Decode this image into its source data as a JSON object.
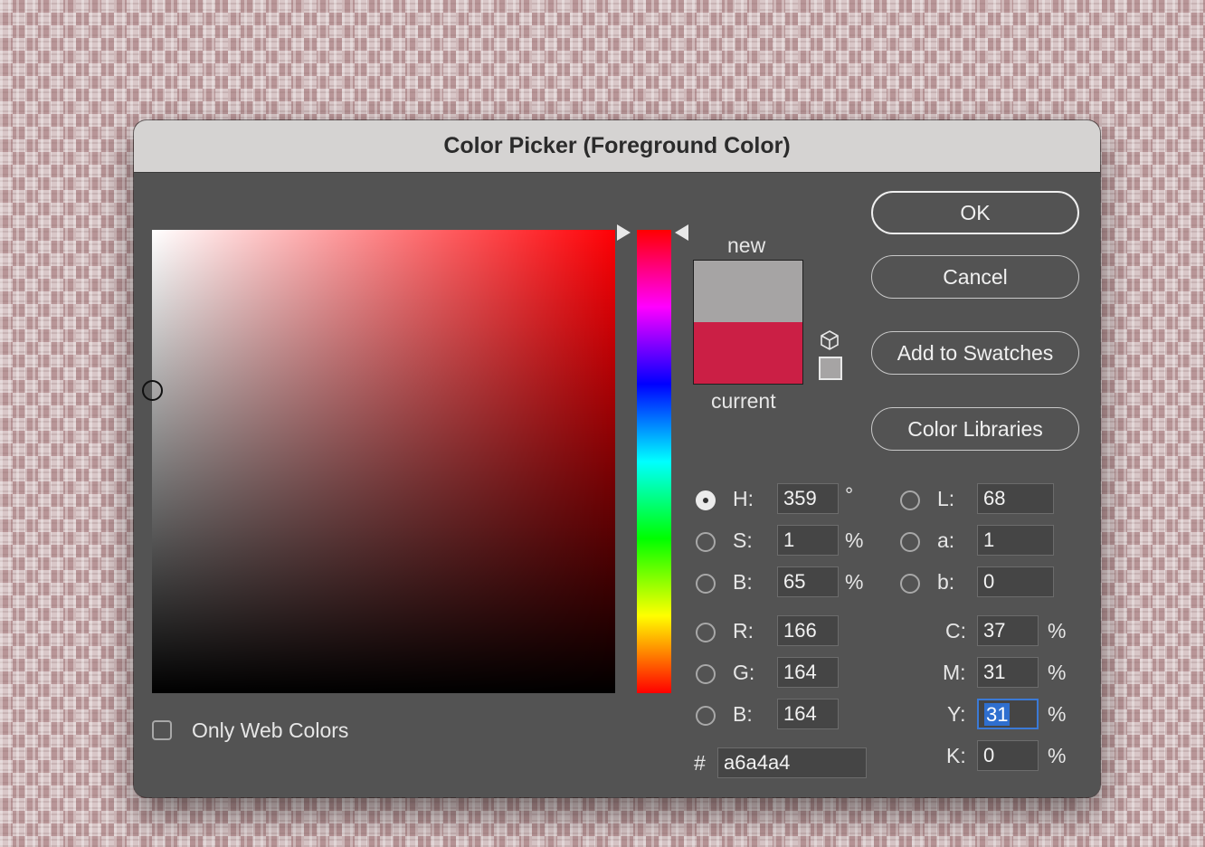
{
  "dialog": {
    "title": "Color Picker (Foreground Color)"
  },
  "colors": {
    "new": "#a6a4a4",
    "current": "#cb1f45",
    "field_hue": "#ff0005"
  },
  "preview": {
    "new_label": "new",
    "current_label": "current"
  },
  "buttons": {
    "ok": "OK",
    "cancel": "Cancel",
    "add_to_swatches": "Add to Swatches",
    "color_libraries": "Color Libraries"
  },
  "hsb": {
    "h": {
      "label": "H:",
      "value": "359",
      "unit": "°",
      "selected": true
    },
    "s": {
      "label": "S:",
      "value": "1",
      "unit": "%"
    },
    "b": {
      "label": "B:",
      "value": "65",
      "unit": "%"
    }
  },
  "rgb": {
    "r": {
      "label": "R:",
      "value": "166"
    },
    "g": {
      "label": "G:",
      "value": "164"
    },
    "b": {
      "label": "B:",
      "value": "164"
    }
  },
  "lab": {
    "l": {
      "label": "L:",
      "value": "68"
    },
    "a": {
      "label": "a:",
      "value": "1"
    },
    "b": {
      "label": "b:",
      "value": "0"
    }
  },
  "cmyk": {
    "c": {
      "label": "C:",
      "value": "37",
      "unit": "%"
    },
    "m": {
      "label": "M:",
      "value": "31",
      "unit": "%"
    },
    "y": {
      "label": "Y:",
      "value": "31",
      "unit": "%"
    },
    "k": {
      "label": "K:",
      "value": "0",
      "unit": "%"
    }
  },
  "hex": {
    "label": "#",
    "value": "a6a4a4"
  },
  "only_web_colors": {
    "label": "Only Web Colors",
    "checked": false
  }
}
